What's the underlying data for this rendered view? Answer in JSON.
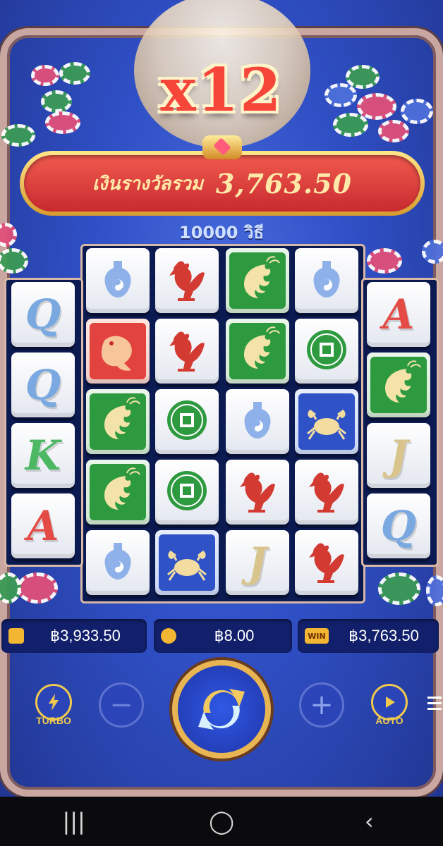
{
  "header": {
    "multiplier": "x12",
    "total_win_label": "เงินรางวัลรวม",
    "total_win_value": "3,763.50",
    "ways": "10000 วิธี"
  },
  "board": {
    "reels": [
      [
        "Q",
        "Q",
        "K",
        "A"
      ],
      [
        "gourd",
        "koi",
        "shrimp",
        "shrimp",
        "gourd"
      ],
      [
        "rooster",
        "rooster",
        "coin",
        "coin",
        "crab"
      ],
      [
        "shrimp",
        "shrimp",
        "gourd",
        "rooster",
        "J"
      ],
      [
        "gourd",
        "coin",
        "crab",
        "rooster",
        "rooster"
      ],
      [
        "A",
        "shrimp",
        "J",
        "Q"
      ]
    ],
    "letters": {
      "Q": "Q",
      "K": "K",
      "A": "A",
      "J": "J"
    }
  },
  "status": {
    "balance": "฿3,933.50",
    "bet": "฿8.00",
    "win": "฿3,763.50",
    "win_icon_text": "WIN"
  },
  "controls": {
    "turbo_label": "TURBO",
    "auto_label": "AUTO",
    "minus_symbol": "−",
    "plus_symbol": "+"
  },
  "navbar": {
    "recent": "|||",
    "home": "◯",
    "back": "‹"
  },
  "colors": {
    "accent_gold": "#f0c94e",
    "banner_red": "#e0403a",
    "panel_blue": "#12206c"
  }
}
